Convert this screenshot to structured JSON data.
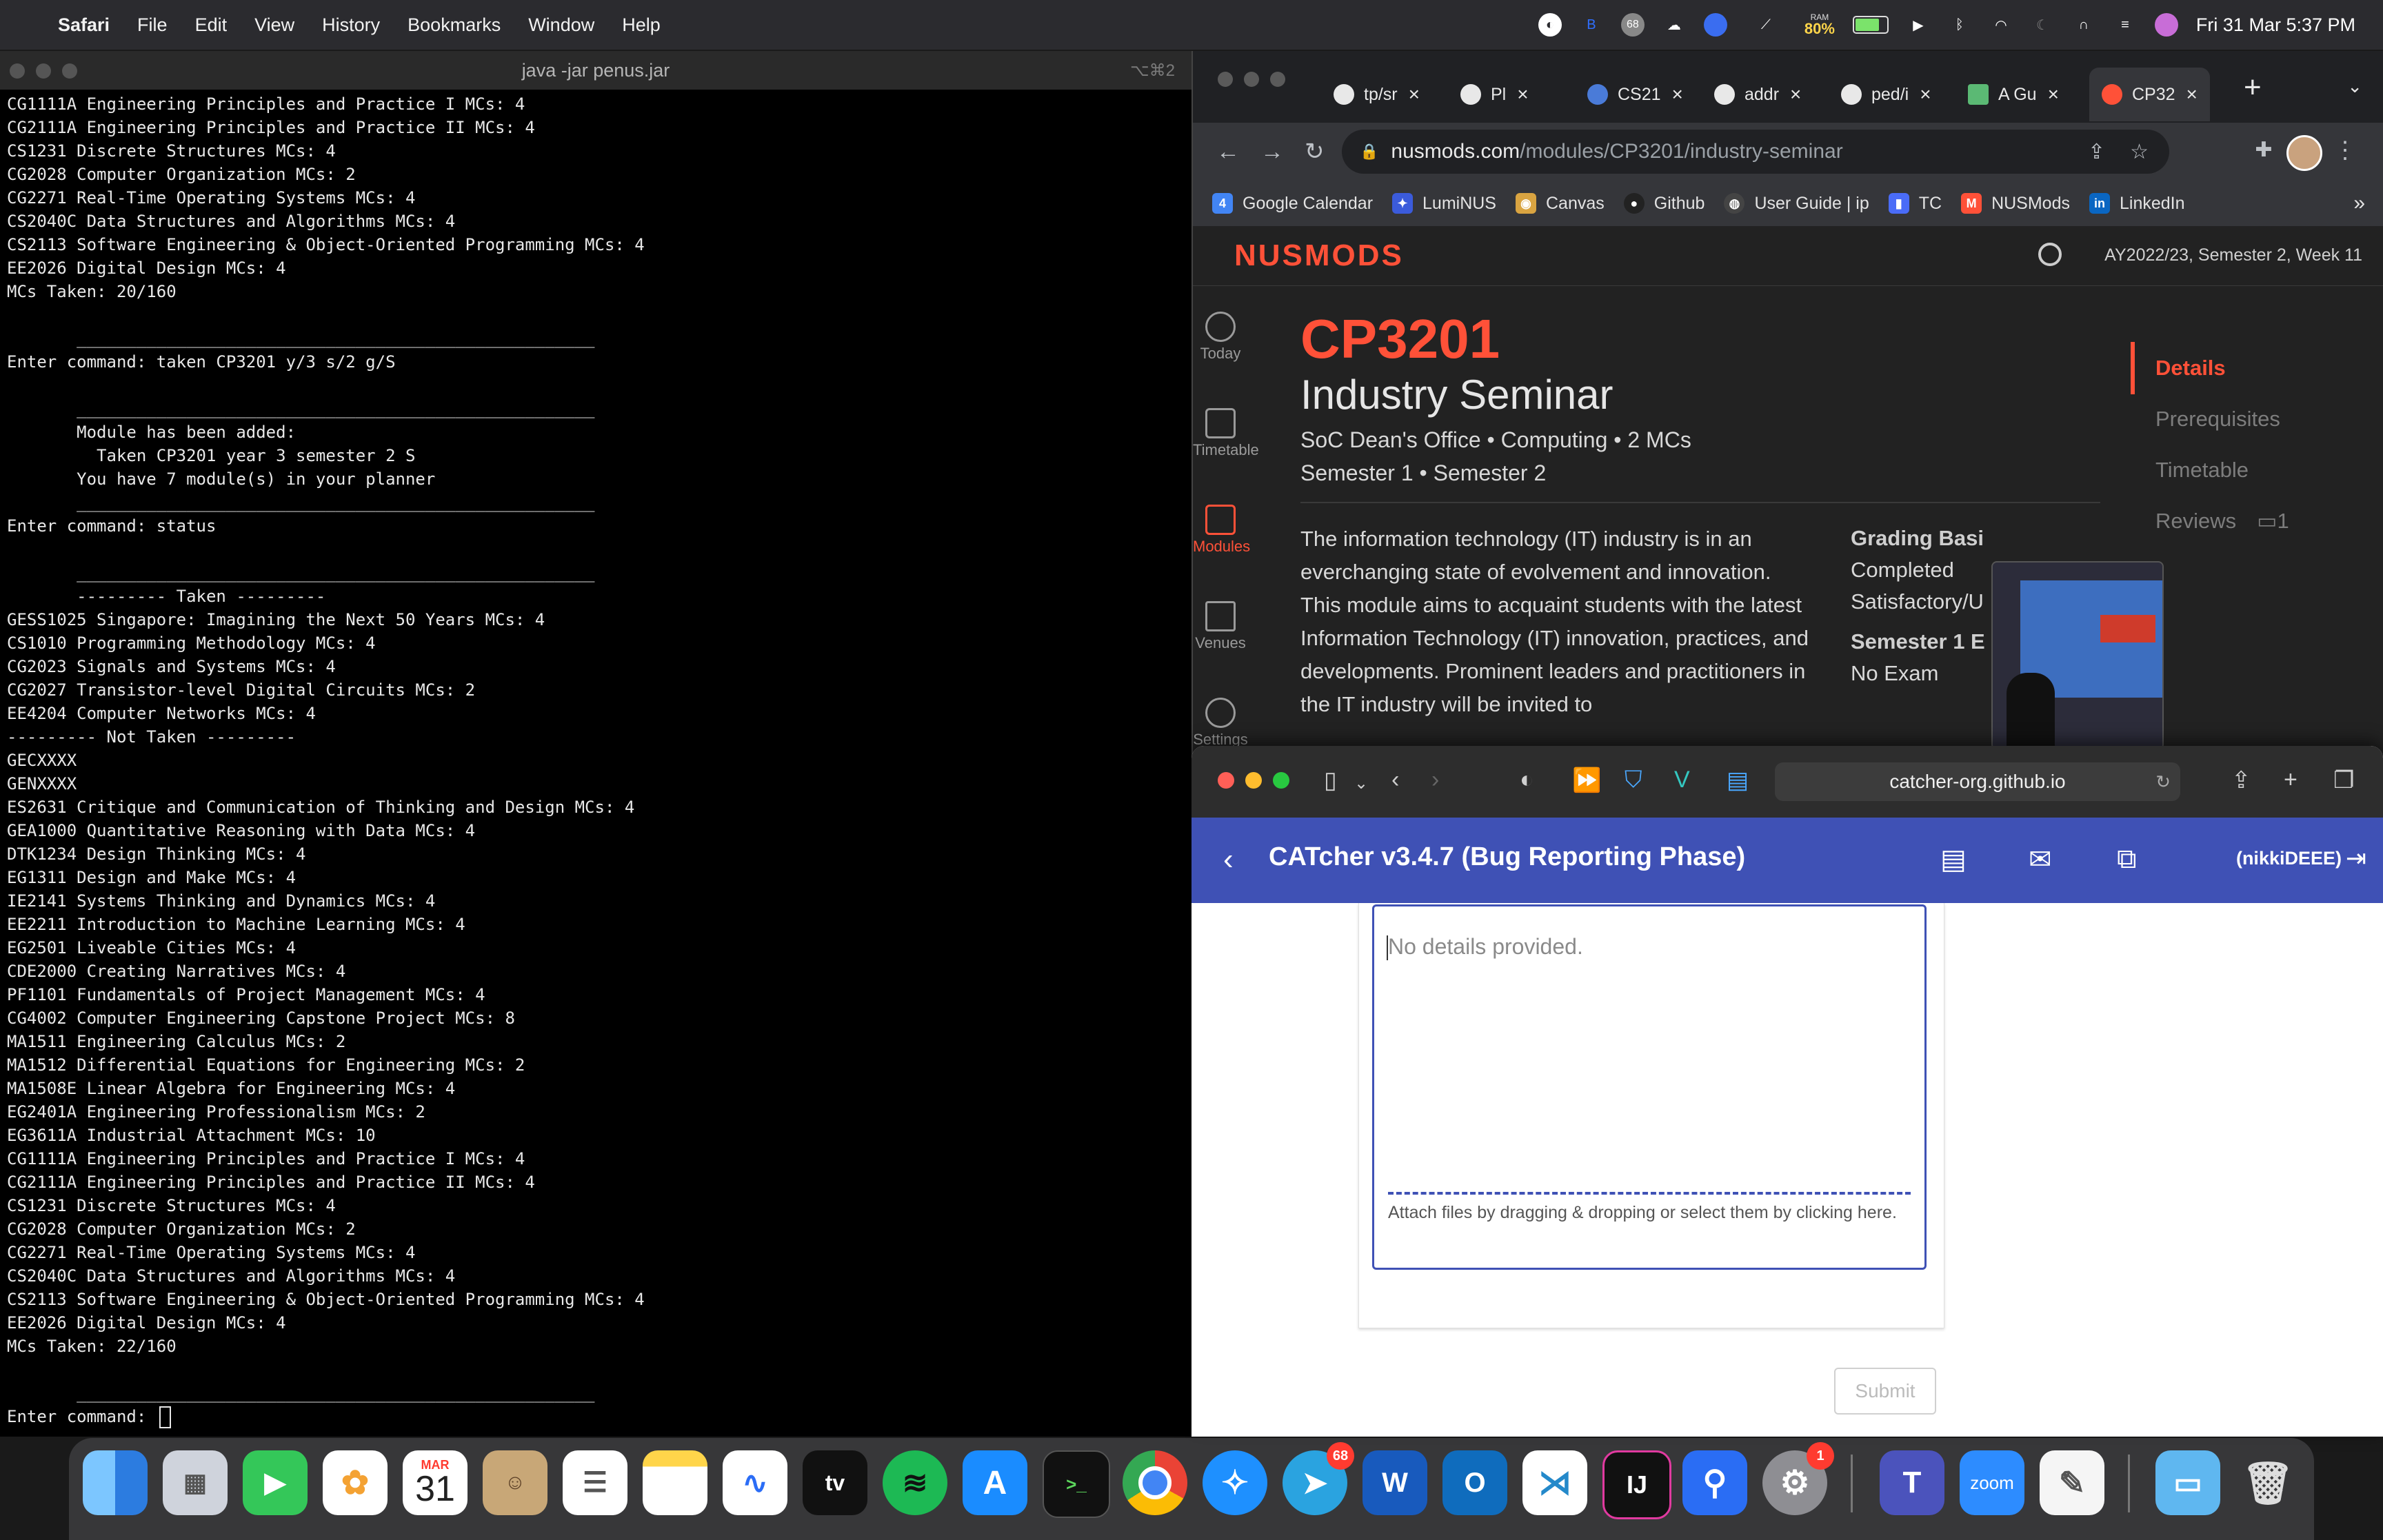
{
  "menubar": {
    "app": "Safari",
    "items": [
      "File",
      "Edit",
      "View",
      "History",
      "Bookmarks",
      "Window",
      "Help"
    ],
    "ram_label": "RAM",
    "ram_value": "80%",
    "badge": "68",
    "datetime": "Fri 31 Mar  5:37 PM"
  },
  "terminal": {
    "title": "java -jar penus.jar",
    "shortcut": "⌥⌘2",
    "lines": [
      "CG1111A Engineering Principles and Practice I MCs: 4",
      "CG2111A Engineering Principles and Practice II MCs: 4",
      "CS1231 Discrete Structures MCs: 4",
      "CG2028 Computer Organization MCs: 2",
      "CG2271 Real-Time Operating Systems MCs: 4",
      "CS2040C Data Structures and Algorithms MCs: 4",
      "CS2113 Software Engineering & Object-Oriented Programming MCs: 4",
      "EE2026 Digital Design MCs: 4",
      "MCs Taken: 20/160",
      "",
      "       ____________________________________________________",
      "Enter command: taken CP3201 y/3 s/2 g/S",
      "",
      "       ____________________________________________________",
      "       Module has been added:",
      "         Taken CP3201 year 3 semester 2 S",
      "       You have 7 module(s) in your planner",
      "       ____________________________________________________",
      "Enter command: status",
      "",
      "       ____________________________________________________",
      "       --------- Taken ---------",
      "GESS1025 Singapore: Imagining the Next 50 Years MCs: 4",
      "CS1010 Programming Methodology MCs: 4",
      "CG2023 Signals and Systems MCs: 4",
      "CG2027 Transistor-level Digital Circuits MCs: 2",
      "EE4204 Computer Networks MCs: 4",
      "--------- Not Taken ---------",
      "GECXXXX",
      "GENXXXX",
      "ES2631 Critique and Communication of Thinking and Design MCs: 4",
      "GEA1000 Quantitative Reasoning with Data MCs: 4",
      "DTK1234 Design Thinking MCs: 4",
      "EG1311 Design and Make MCs: 4",
      "IE2141 Systems Thinking and Dynamics MCs: 4",
      "EE2211 Introduction to Machine Learning MCs: 4",
      "EG2501 Liveable Cities MCs: 4",
      "CDE2000 Creating Narratives MCs: 4",
      "PF1101 Fundamentals of Project Management MCs: 4",
      "CG4002 Computer Engineering Capstone Project MCs: 8",
      "MA1511 Engineering Calculus MCs: 2",
      "MA1512 Differential Equations for Engineering MCs: 2",
      "MA1508E Linear Algebra for Engineering MCs: 4",
      "EG2401A Engineering Professionalism MCs: 2",
      "EG3611A Industrial Attachment MCs: 10",
      "CG1111A Engineering Principles and Practice I MCs: 4",
      "CG2111A Engineering Principles and Practice II MCs: 4",
      "CS1231 Discrete Structures MCs: 4",
      "CG2028 Computer Organization MCs: 2",
      "CG2271 Real-Time Operating Systems MCs: 4",
      "CS2040C Data Structures and Algorithms MCs: 4",
      "CS2113 Software Engineering & Object-Oriented Programming MCs: 4",
      "EE2026 Digital Design MCs: 4",
      "MCs Taken: 22/160",
      "",
      "       ____________________________________________________",
      "Enter command: "
    ]
  },
  "chrome": {
    "tabs": [
      {
        "label": "tp/sr",
        "icon": "github-icon"
      },
      {
        "label": "Pl",
        "icon": "globe-icon"
      },
      {
        "label": "CS21",
        "icon": "graduation-cap-icon"
      },
      {
        "label": "addr",
        "icon": "github-icon"
      },
      {
        "label": "ped/i",
        "icon": "github-icon"
      },
      {
        "label": "A Gu",
        "icon": "document-icon"
      },
      {
        "label": "CP32",
        "icon": "nusmods-icon"
      }
    ],
    "url_host": "nusmods.com",
    "url_path": "/modules/CP3201/industry-seminar",
    "bookmarks": [
      {
        "label": "Google Calendar",
        "icon": "calendar-icon",
        "color": "#4285f4",
        "glyph": "4"
      },
      {
        "label": "LumiNUS",
        "icon": "luminus-icon",
        "color": "#3b5bdb",
        "glyph": "✦"
      },
      {
        "label": "Canvas",
        "icon": "canvas-icon",
        "color": "#d9a441",
        "glyph": "◉"
      },
      {
        "label": "Github",
        "icon": "github-icon",
        "color": "#222222",
        "glyph": "●"
      },
      {
        "label": "User Guide | ip",
        "icon": "globe-icon",
        "color": "#444444",
        "glyph": "◍"
      },
      {
        "label": "TC",
        "icon": "tc-icon",
        "color": "#4a6cf7",
        "glyph": "▮"
      },
      {
        "label": "NUSMods",
        "icon": "nusmods-icon",
        "color": "#ff5138",
        "glyph": "M"
      },
      {
        "label": "LinkedIn",
        "icon": "linkedin-icon",
        "color": "#0a66c2",
        "glyph": "in"
      }
    ],
    "bookmarks_more": "»"
  },
  "nusmods": {
    "logo": "NUSMODS",
    "semester": "AY2022/23, Semester 2, Week 11",
    "sidebar": [
      {
        "label": "Today",
        "icon": "clock-icon"
      },
      {
        "label": "Timetable",
        "icon": "calendar-icon"
      },
      {
        "label": "Modules",
        "icon": "book-icon"
      },
      {
        "label": "Venues",
        "icon": "map-icon"
      },
      {
        "label": "Settings",
        "icon": "gear-icon"
      }
    ],
    "module_code": "CP3201",
    "module_title": "Industry Seminar",
    "meta": "SoC Dean's Office • Computing • 2 MCs",
    "semesters": "Semester 1 • Semester 2",
    "description": "The information technology (IT) industry is in an everchanging state of evolvement and innovation. This module aims to acquaint students with the latest Information Technology (IT) innovation, practices, and developments. Prominent leaders and practitioners in the IT industry will be invited to",
    "grading_heading": "Grading Basi",
    "grading_value1": "Completed",
    "grading_value2": "Satisfactory/U",
    "exam_heading": "Semester 1 E",
    "exam_value": "No Exam",
    "toc": [
      "Details",
      "Prerequisites",
      "Timetable",
      "Reviews"
    ],
    "reviews_count": "1"
  },
  "safari": {
    "url": "catcher-org.github.io",
    "app_title": "CATcher v3.4.7  (Bug Reporting Phase)",
    "user": "(nikkiDEEE)",
    "editor_placeholder": "No details provided.",
    "attach_hint": "Attach files by dragging & dropping or select them by clicking here.",
    "submit": "Submit"
  },
  "dock": {
    "calendar_month": "MAR",
    "calendar_day": "31",
    "telegram_badge": "68",
    "settings_badge": "1",
    "zoom_label": "zoom",
    "intellij_label": "IJ",
    "word_label": "W",
    "outlook_label": "O",
    "terminal_label": ">_",
    "appletv_label": "tv"
  }
}
